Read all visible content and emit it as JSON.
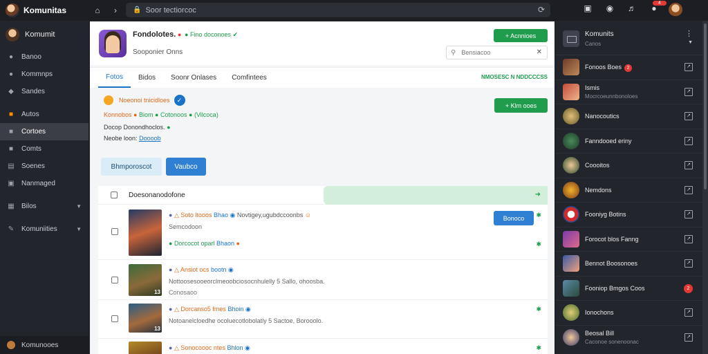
{
  "app": {
    "name": "Komunitas"
  },
  "topbar": {
    "back_icon": "back-arrow",
    "forward_icon": "forward-arrow",
    "url": "Soor tectiorcoc",
    "notifications_count": "4"
  },
  "sidebar": {
    "user_name": "Komumit",
    "items": [
      {
        "label": "Banoo",
        "icon": "person-icon"
      },
      {
        "label": "Kommnps",
        "icon": "people-icon"
      },
      {
        "label": "Sandes",
        "icon": "shield-icon"
      },
      {
        "label": "Autos",
        "icon": "orange-square-icon"
      },
      {
        "label": "Cortoes",
        "icon": "folder-icon"
      },
      {
        "label": "Comts",
        "icon": "doc-icon"
      },
      {
        "label": "Soenes",
        "icon": "list-icon"
      },
      {
        "label": "Nanmaged",
        "icon": "image-icon"
      },
      {
        "label": "Bilos",
        "icon": "grid-icon"
      },
      {
        "label": "Komuniities",
        "icon": "wrench-icon"
      }
    ],
    "footer": "Komunooes"
  },
  "profile": {
    "name": "Fondolotes.",
    "verified": "Fino doconoes",
    "subtitle": "Sooponier Onns",
    "follow_button": "+ Acnnioes",
    "search_placeholder": "Bensiacoo"
  },
  "tabs": {
    "items": [
      "Fotos",
      "Bidos",
      "Soonr Onlases",
      "Comfintees"
    ],
    "active": 0,
    "right_label": "NMOSESC N NDDCCCSS"
  },
  "info": {
    "line1": "Noeonoi tnicidloes",
    "line2_a": "Konnobos",
    "line2_b": "Biom",
    "line2_c": "Cotonoos",
    "line2_d": "(Vilcoca)",
    "line3": "Docop Donondhoclos.",
    "line4_label": "Neobe loon:",
    "line4_link": "Doooob",
    "side_button": "+ Klm ooes",
    "btn_primary_light": "Bhmporoscot",
    "btn_primary": "Vaubco"
  },
  "list": {
    "header": "Doesonanodofone",
    "rows": [
      {
        "l1_a": "Soto ltooos",
        "l1_b": "Bhao",
        "l1_c": "Novtigey,ugubdccoonbs",
        "l2": "Semcodoon",
        "l3_a": "Dorcocot oparl",
        "l3_b": "Bhaon",
        "button": "Bonoco",
        "thumb_num": ""
      },
      {
        "l1_a": "Ansiot ocs",
        "l1_b": "bootn",
        "l2": "Nottoosesooeorclmeoobciosocnhulelly 5 Sallo, ohoosba.",
        "l4": "Conosaoo",
        "thumb_num": "13"
      },
      {
        "l1_a": "Dorcanso5 fmes",
        "l1_b": "Bhoin",
        "l2": "Notoanelcloedhe ocoluecotlobolatly 5 Sactoe, Borooolo.",
        "thumb_num": "13"
      },
      {
        "l1_a": "Sonocoooc ntes",
        "l1_b": "Bhlon",
        "thumb_num": ""
      }
    ]
  },
  "right_sidebar": {
    "title": "Komunits",
    "subtitle": "Canos",
    "items": [
      {
        "name": "Fonoos Boes",
        "sub": "",
        "badge": "2"
      },
      {
        "name": "Ismis",
        "sub": "Mocrcoeunnbonoloes"
      },
      {
        "name": "Nanocoutics",
        "sub": ""
      },
      {
        "name": "Fanndooed eriny",
        "sub": ""
      },
      {
        "name": "Coooitos",
        "sub": ""
      },
      {
        "name": "Nemdons",
        "sub": ""
      },
      {
        "name": "Fooniyg Botins",
        "sub": ""
      },
      {
        "name": "Forocot blos Fanng",
        "sub": ""
      },
      {
        "name": "Bennot Boosonoes",
        "sub": ""
      },
      {
        "name": "Fooniop Bmgos Coos",
        "sub": "",
        "red": "2"
      },
      {
        "name": "Ionochons",
        "sub": ""
      },
      {
        "name": "Beosal Bill",
        "sub": "Caconoe sonenoonac"
      }
    ]
  },
  "colors": {
    "accent_blue": "#2f7fd3",
    "accent_green": "#1f9d4d",
    "sidebar_bg": "#23252c"
  }
}
